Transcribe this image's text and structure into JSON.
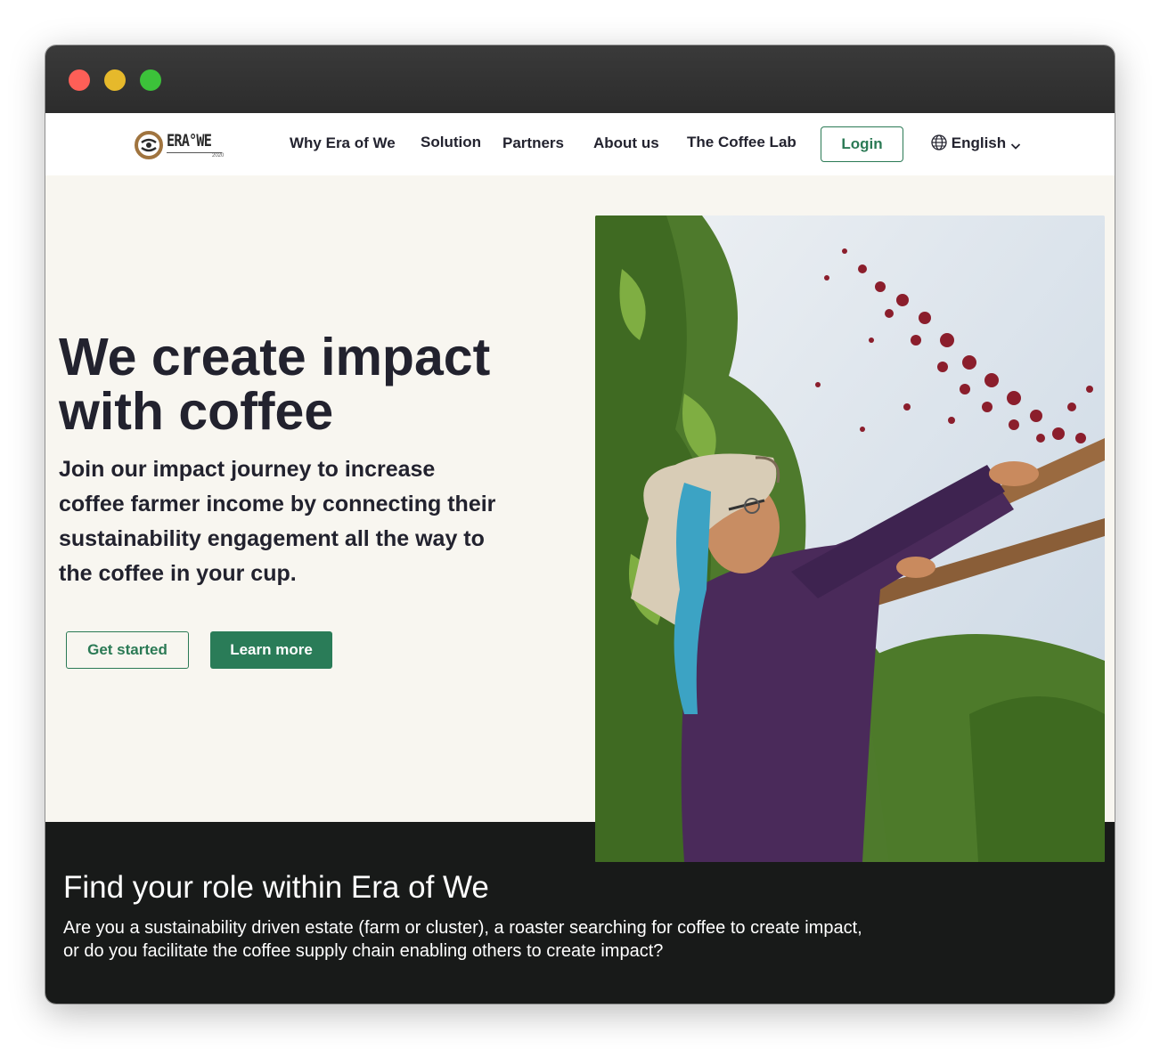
{
  "nav": {
    "logo_text": "ERA°WE",
    "logo_year": "2020",
    "links": [
      "Why Era of We",
      "Solution",
      "Partners",
      "About us",
      "The Coffee Lab"
    ],
    "login_label": "Login",
    "language_label": "English",
    "language_icon": "globe-icon",
    "dropdown_icon": "chevron-down-icon"
  },
  "hero": {
    "title": "We create impact with coffee",
    "subtitle": "Join our impact journey to increase coffee farmer income by connecting their sustainability engagement all the way to the coffee in your cup.",
    "primary_button": "Learn more",
    "secondary_button": "Get started"
  },
  "role": {
    "title": "Find your role within Era of We",
    "text": "Are you a sustainability driven estate (farm or cluster), a roaster searching for coffee to create impact, or do you facilitate the coffee supply chain enabling others to create impact?"
  },
  "colors": {
    "accent": "#2a7c58",
    "page_bg": "#f8f6f0",
    "dark_bg": "#181a19",
    "heading": "#22222e"
  }
}
